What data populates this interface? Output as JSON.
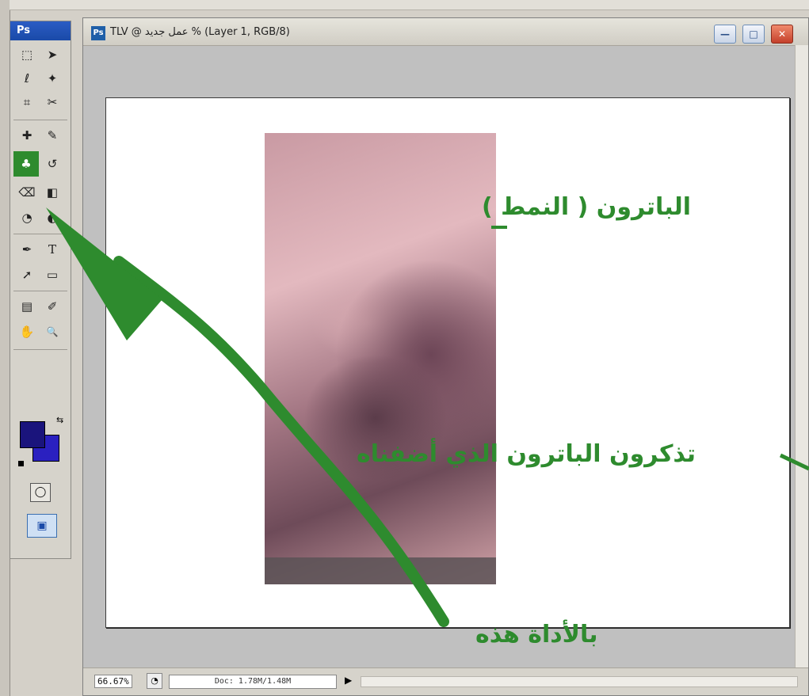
{
  "toolbox": {
    "header": "Ps",
    "tools": [
      {
        "name": "marquee-tool",
        "glyph": "⬚"
      },
      {
        "name": "move-tool",
        "glyph": "➤"
      },
      {
        "name": "lasso-tool",
        "glyph": "ℓ"
      },
      {
        "name": "magic-wand-tool",
        "glyph": "✦"
      },
      {
        "name": "crop-tool",
        "glyph": "⌗"
      },
      {
        "name": "slice-tool",
        "glyph": "✂"
      },
      {
        "name": "healing-brush-tool",
        "glyph": "✚"
      },
      {
        "name": "brush-tool",
        "glyph": "✎"
      },
      {
        "name": "pattern-stamp-tool",
        "glyph": "♣"
      },
      {
        "name": "history-brush-tool",
        "glyph": "↺"
      },
      {
        "name": "eraser-tool",
        "glyph": "⌫"
      },
      {
        "name": "gradient-tool",
        "glyph": "◧"
      },
      {
        "name": "blur-tool",
        "glyph": "◔"
      },
      {
        "name": "dodge-tool",
        "glyph": "◐"
      },
      {
        "name": "pen-tool",
        "glyph": "✒"
      },
      {
        "name": "type-tool",
        "glyph": "T"
      },
      {
        "name": "path-selection-tool",
        "glyph": "➚"
      },
      {
        "name": "shape-tool",
        "glyph": "▭"
      },
      {
        "name": "notes-tool",
        "glyph": "▤"
      },
      {
        "name": "eyedropper-tool",
        "glyph": "✐"
      },
      {
        "name": "hand-tool",
        "glyph": "✋"
      },
      {
        "name": "zoom-tool",
        "glyph": "🔍"
      }
    ],
    "active_tool": "pattern-stamp-tool",
    "foreground_color": "#1a147c",
    "background_color": "#2a20c0",
    "quick_mask_glyph": "◯",
    "screen_mode_glyph": "▣"
  },
  "document": {
    "icon_label": "Ps",
    "title": "TLV @ عمل جديد % (Layer 1, RGB/8)",
    "min_glyph": "—",
    "max_glyph": "□",
    "close_glyph": "✕",
    "zoom": "66.67%",
    "doc_info": "Doc: 1.78M/1.48M",
    "status_arrow": "▶"
  },
  "annotations": {
    "pattern_stamp": "الباترون ( النمط )",
    "remember_pattern": "تذكرون الباترون الذي أضفناه",
    "with_this_tool": "بالأداة هذه"
  },
  "colors": {
    "annotation_green": "#2e8b2e",
    "title_blue": "#1a4aa8"
  }
}
